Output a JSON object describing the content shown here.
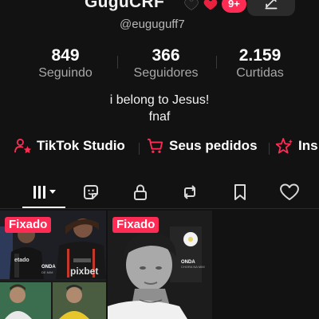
{
  "profile": {
    "display_name": "GuguCRF",
    "notification_badge": "9+",
    "username": "@euguguff7"
  },
  "stats": [
    {
      "value": "849",
      "label": "Seguindo"
    },
    {
      "value": "366",
      "label": "Seguidores"
    },
    {
      "value": "2.159",
      "label": "Curtidas"
    }
  ],
  "bio": {
    "line1": "i belong to Jesus!",
    "line2": "fnaf"
  },
  "links": [
    {
      "label": "TikTok Studio",
      "icon": "person-star-icon"
    },
    {
      "label": "Seus pedidos",
      "icon": "cart-icon"
    },
    {
      "label": "Ins",
      "icon": "sparkle-icon"
    }
  ],
  "tabs": [
    {
      "id": "videos",
      "icon": "grid-icon",
      "active": true
    },
    {
      "id": "stickers",
      "icon": "sticker-icon"
    },
    {
      "id": "private",
      "icon": "lock-icon"
    },
    {
      "id": "reposts",
      "icon": "repost-icon"
    },
    {
      "id": "favorites",
      "icon": "bookmark-icon"
    },
    {
      "id": "liked",
      "icon": "heart-outline-icon"
    }
  ],
  "grid": {
    "pinned_label_1": "Fixado",
    "pinned_label_2": "Fixado"
  },
  "colors": {
    "background": "#121212",
    "accent": "#fe2c55",
    "muted_text": "#a8a8a8"
  }
}
